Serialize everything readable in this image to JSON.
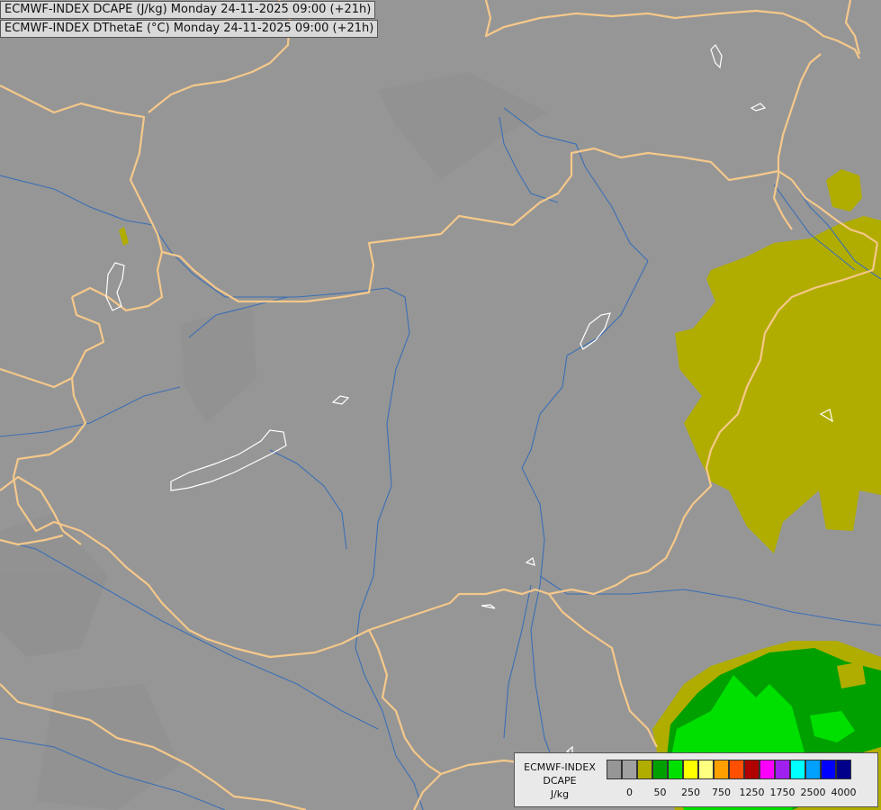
{
  "titles": {
    "line1": "ECMWF-INDEX DCAPE (J/kg) Monday 24-11-2025 09:00 (+21h)",
    "line2": "ECMWF-INDEX DThetaE (°C) Monday 24-11-2025 09:00 (+21h)"
  },
  "legend": {
    "line1": "ECMWF-INDEX",
    "line2": "DCAPE",
    "line3": "J/kg",
    "colors": [
      "#969696",
      "#a0a0a0",
      "#b0ad00",
      "#00a000",
      "#00e000",
      "#ffff00",
      "#ffff80",
      "#ffa000",
      "#ff5000",
      "#b00000",
      "#ff00ff",
      "#a020f0",
      "#00ffff",
      "#00a0ff",
      "#0000ff",
      "#00008b"
    ],
    "ticks": [
      "0",
      "50",
      "250",
      "750",
      "1250",
      "1750",
      "2500",
      "4000"
    ]
  },
  "colors": {
    "background": "#969696",
    "border": "#f5c88a",
    "river": "#3b6fb6",
    "lake": "#ffffff",
    "olive": "#b0ad00",
    "green": "#00a000",
    "bright_green": "#00e000"
  }
}
